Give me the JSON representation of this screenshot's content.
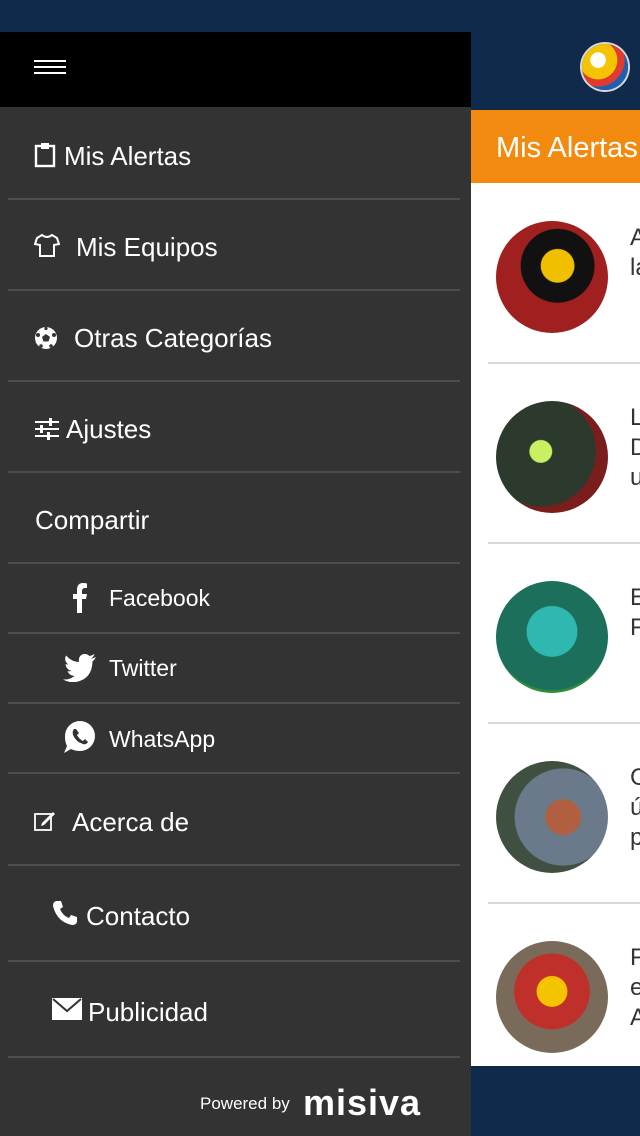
{
  "app": {
    "title": "Mis Alertas",
    "feed": [
      {
        "text": "A\nla"
      },
      {
        "text": "L\nD\nu"
      },
      {
        "text": "E\nF"
      },
      {
        "text": "C\nú\np"
      },
      {
        "text": "F\ne\nA"
      }
    ]
  },
  "drawer": {
    "items": [
      {
        "label": "Mis Alertas",
        "icon": "clipboard-icon"
      },
      {
        "label": "Mis Equipos",
        "icon": "shirt-icon"
      },
      {
        "label": "Otras Categorías",
        "icon": "soccer-ball-icon"
      },
      {
        "label": "Ajustes",
        "icon": "sliders-icon"
      },
      {
        "label": "Compartir"
      },
      {
        "label": "Facebook",
        "icon": "facebook-icon"
      },
      {
        "label": "Twitter",
        "icon": "twitter-icon"
      },
      {
        "label": "WhatsApp",
        "icon": "whatsapp-icon"
      },
      {
        "label": "Acerca de",
        "icon": "edit-icon"
      },
      {
        "label": "Contacto",
        "icon": "phone-icon"
      },
      {
        "label": "Publicidad",
        "icon": "mail-icon"
      }
    ],
    "powered_by": "Powered by",
    "brand": "misiva"
  },
  "colors": {
    "accent": "#f28a10",
    "navy": "#0f2a4a",
    "drawer": "#333333"
  }
}
